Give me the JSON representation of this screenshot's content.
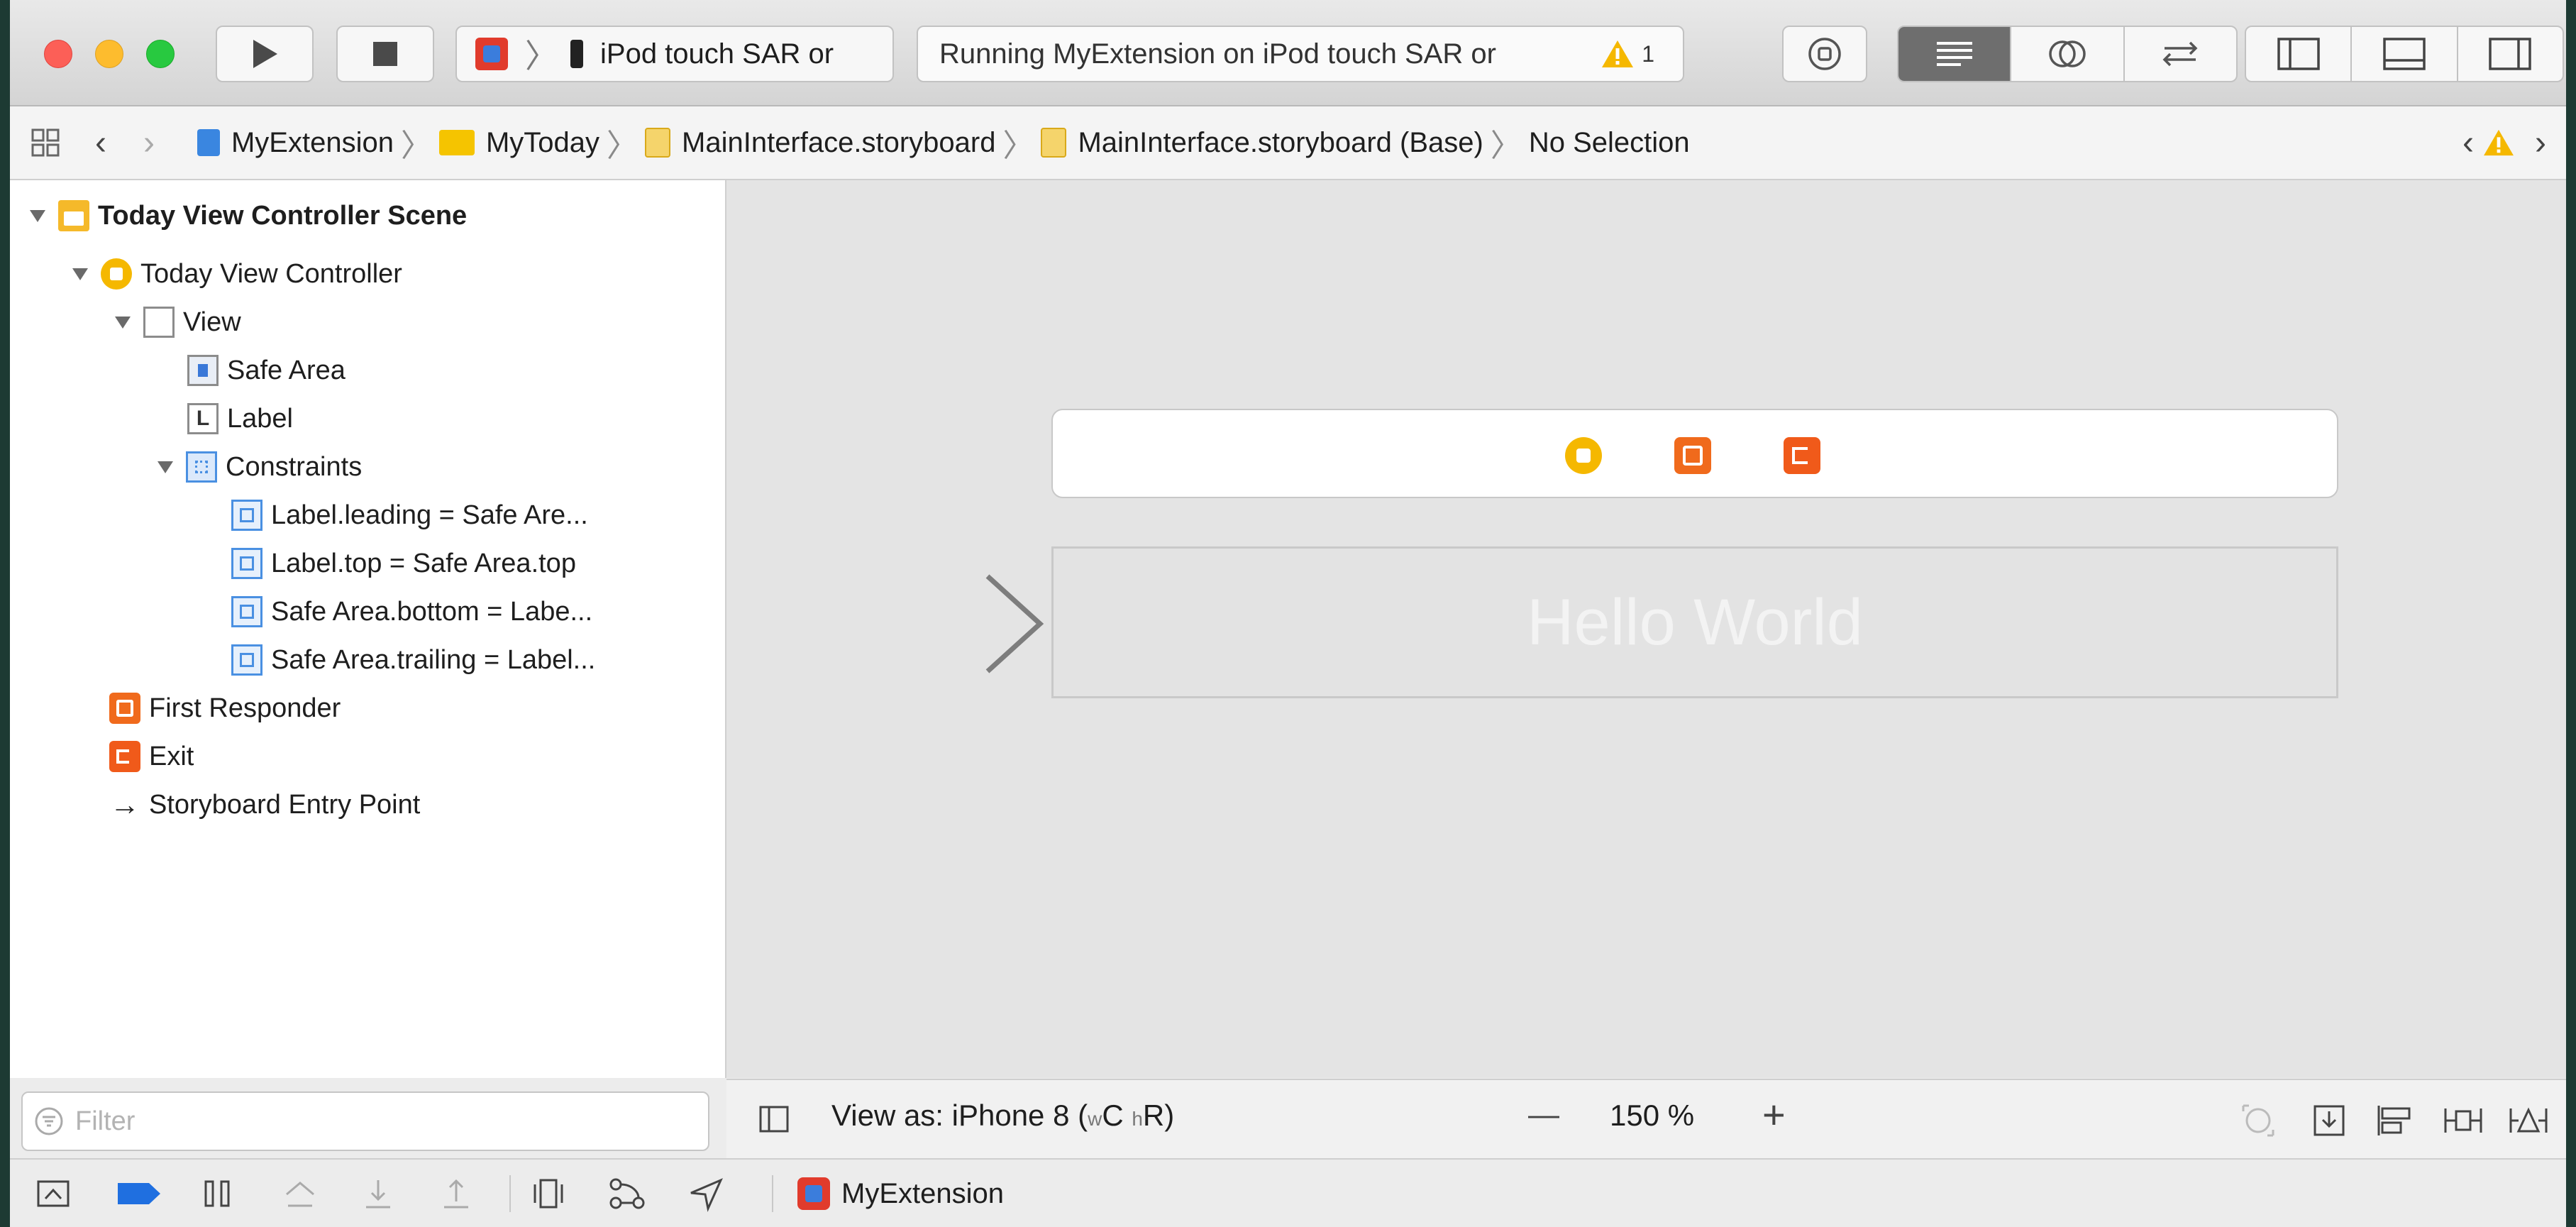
{
  "toolbar": {
    "scheme_device": "iPod touch SAR or",
    "activity_status": "Running MyExtension on iPod touch SAR or",
    "warning_count": "1"
  },
  "jumpbar": {
    "crumbs": [
      "MyExtension",
      "MyToday",
      "MainInterface.storyboard",
      "MainInterface.storyboard (Base)",
      "No Selection"
    ]
  },
  "outline": {
    "items": [
      {
        "label": "Today View Controller Scene",
        "icon": "scene-icon"
      },
      {
        "label": "Today View Controller",
        "icon": "view-controller-icon"
      },
      {
        "label": "View",
        "icon": "view-icon"
      },
      {
        "label": "Safe Area",
        "icon": "safe-area-icon"
      },
      {
        "label": "Label",
        "icon": "label-icon"
      },
      {
        "label": "Constraints",
        "icon": "constraints-icon"
      },
      {
        "label": "Label.leading = Safe Are...",
        "icon": "constraint-icon"
      },
      {
        "label": "Label.top = Safe Area.top",
        "icon": "constraint-icon"
      },
      {
        "label": "Safe Area.bottom = Labe...",
        "icon": "constraint-icon"
      },
      {
        "label": "Safe Area.trailing = Label...",
        "icon": "constraint-icon"
      },
      {
        "label": "First Responder",
        "icon": "first-responder-icon"
      },
      {
        "label": "Exit",
        "icon": "exit-icon"
      },
      {
        "label": "Storyboard Entry Point",
        "icon": "arrow-icon"
      }
    ],
    "filter_placeholder": "Filter",
    "label_glyph": "L"
  },
  "canvas": {
    "label_text": "Hello World",
    "view_as_prefix": "View as: iPhone 8 (",
    "view_as_w": "w",
    "view_as_c": "C ",
    "view_as_h": "h",
    "view_as_r": "R",
    "view_as_suffix": ")",
    "zoom": "150 %",
    "zoom_out_symbol": "—",
    "zoom_in_symbol": "+"
  },
  "debug_bar": {
    "target": "MyExtension"
  },
  "colors": {
    "accent_blue": "#1f6fe0",
    "warning_yellow": "#f5b800",
    "object_orange": "#f06a1c"
  }
}
